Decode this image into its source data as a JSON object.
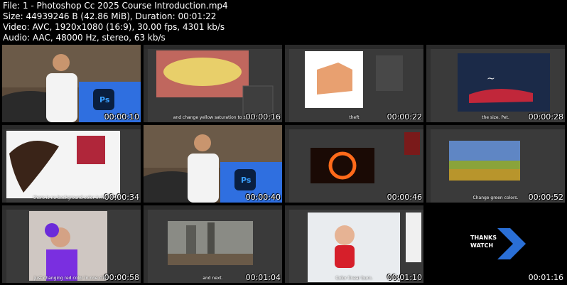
{
  "file_info": {
    "line1": "File: 1 - Photoshop Cc 2025 Course Introduction.mp4",
    "line2": "Size: 44939246 B (42.86 MiB), Duration: 00:01:22",
    "line3": "Video: AVC, 1920x1080 (16:9), 30.00 fps, 4301 kb/s",
    "line4": "Audio: AAC, 48000 Hz, stereo, 63 kb/s"
  },
  "thumbnails": [
    {
      "time": "00:00:10",
      "caption": ""
    },
    {
      "time": "00:00:16",
      "caption": "and change yellow saturation to zero"
    },
    {
      "time": "00:00:22",
      "caption": "theft"
    },
    {
      "time": "00:00:28",
      "caption": "the size. Pet."
    },
    {
      "time": "00:00:34",
      "caption": "there is no background color in hair"
    },
    {
      "time": "00:00:40",
      "caption": ""
    },
    {
      "time": "00:00:46",
      "caption": ""
    },
    {
      "time": "00:00:52",
      "caption": "Change green colors."
    },
    {
      "time": "00:00:58",
      "caption": "Just changing red color in one click"
    },
    {
      "time": "00:01:04",
      "caption": "and next."
    },
    {
      "time": "00:01:10",
      "caption": "Color linear burn."
    },
    {
      "time": "00:01:16",
      "caption": ""
    }
  ],
  "ps_logo": "Ps",
  "end_card": {
    "line1": "THANKS",
    "line2": "WATCH"
  },
  "colors": {
    "background": "#000000",
    "ps_blue": "#2f6fe0",
    "end_chevron": "#2a6fd6"
  }
}
